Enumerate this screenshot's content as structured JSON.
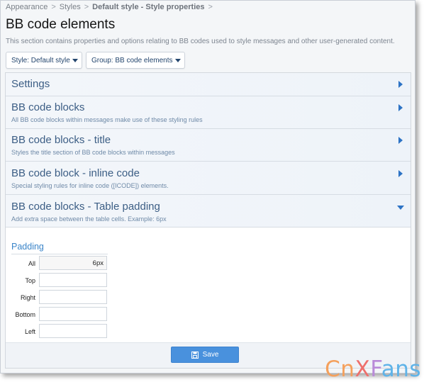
{
  "breadcrumb": {
    "items": [
      "Appearance",
      "Styles"
    ],
    "current": "Default style - Style properties",
    "separator": ">"
  },
  "page": {
    "title": "BB code elements",
    "description": "This section contains properties and options relating to BB codes used to style messages and other user-generated content."
  },
  "filters": {
    "style_label": "Style: Default style",
    "group_label": "Group: BB code elements"
  },
  "sections": [
    {
      "title": "Settings",
      "description": "",
      "state": "collapsed"
    },
    {
      "title": "BB code blocks",
      "description": "All BB code blocks within messages make use of these styling rules",
      "state": "collapsed"
    },
    {
      "title": "BB code blocks - title",
      "description": "Styles the title section of BB code blocks within messages",
      "state": "collapsed"
    },
    {
      "title": "BB code block - inline code",
      "description": "Special styling rules for inline code ([ICODE]) elements.",
      "state": "collapsed"
    },
    {
      "title": "BB code blocks - Table padding",
      "description": "Add extra space between the table cells. Example: 6px",
      "state": "expanded"
    }
  ],
  "padding_group": {
    "title": "Padding",
    "fields": [
      {
        "label": "All",
        "value": "6px"
      },
      {
        "label": "Top",
        "value": ""
      },
      {
        "label": "Right",
        "value": ""
      },
      {
        "label": "Bottom",
        "value": ""
      },
      {
        "label": "Left",
        "value": ""
      }
    ]
  },
  "footer": {
    "save_label": "Save",
    "save_icon": "floppy-disk-icon"
  },
  "watermark": {
    "parts": [
      "Cn",
      "X",
      "F",
      "ans"
    ]
  },
  "colors": {
    "accent": "#4991dd",
    "section_title": "#3c5e85",
    "arrow": "#2d73c5"
  }
}
